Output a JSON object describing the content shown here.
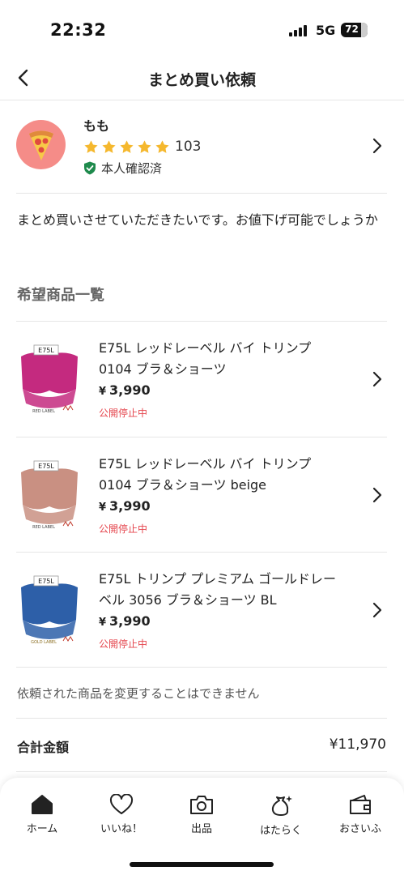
{
  "status_bar": {
    "time": "22:32",
    "network": "5G",
    "battery": "72"
  },
  "header": {
    "title": "まとめ買い依頼"
  },
  "user": {
    "name": "もも",
    "rating_count": "103",
    "star_count": 5,
    "verified_label": "本人確認済"
  },
  "message": "まとめ買いさせていただきたいです。お値下げ可能でしょうか",
  "section_title": "希望商品一覧",
  "items": [
    {
      "title": "E75L レッドレーベル バイ トリンプ 0104 ブラ＆ショーツ",
      "yen": "¥",
      "price": "3,990",
      "status": "公開停止中",
      "thumb_label": "E75L",
      "thumb_brand": "RED LABEL",
      "thumb_color": "#c42a7f"
    },
    {
      "title": "E75L レッドレーベル バイ トリンプ 0104 ブラ＆ショーツ beige",
      "yen": "¥",
      "price": "3,990",
      "status": "公開停止中",
      "thumb_label": "E75L",
      "thumb_brand": "RED LABEL",
      "thumb_color": "#c99082"
    },
    {
      "title": "E75L トリンプ プレミアム ゴールドレーベル 3056 ブラ＆ショーツ BL",
      "yen": "¥",
      "price": "3,990",
      "status": "公開停止中",
      "thumb_label": "E75L",
      "thumb_brand": "GOLD LABEL",
      "thumb_color": "#2d5fa8"
    }
  ],
  "note": "依頼された商品を変更することはできません",
  "total": {
    "label": "合計金額",
    "value": "¥11,970"
  },
  "tabs": [
    {
      "label": "ホーム",
      "icon": "home-icon"
    },
    {
      "label": "いいね！",
      "icon": "heart-icon"
    },
    {
      "label": "出品",
      "icon": "camera-icon"
    },
    {
      "label": "はたらく",
      "icon": "money-bag-icon"
    },
    {
      "label": "おさいふ",
      "icon": "wallet-icon"
    }
  ],
  "colors": {
    "accent_red": "#e5454d",
    "star": "#f5b82e",
    "verified_green": "#1e8a4c",
    "avatar_bg": "#f58c88"
  }
}
